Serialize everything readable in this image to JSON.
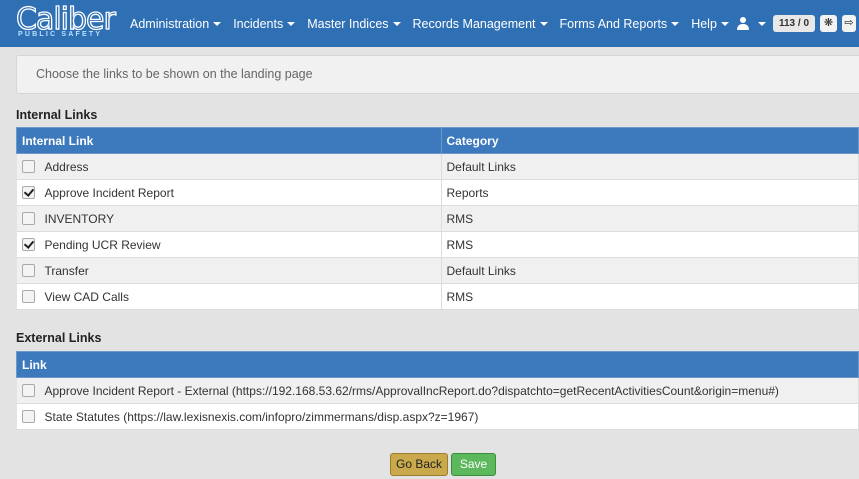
{
  "app": {
    "logo_text": "Caliber",
    "logo_subtext": "PUBLIC SAFETY"
  },
  "nav": {
    "items": [
      {
        "label": "Administration"
      },
      {
        "label": "Incidents"
      },
      {
        "label": "Master Indices"
      },
      {
        "label": "Records Management"
      },
      {
        "label": "Forms And Reports"
      },
      {
        "label": "Help"
      }
    ],
    "badge_count": "113 / 0",
    "icons": [
      "user-icon",
      "gear-icon",
      "logout-icon"
    ]
  },
  "banner": {
    "text": "Choose the links to be shown on the landing page"
  },
  "internal": {
    "title": "Internal Links",
    "headers": {
      "link": "Internal Link",
      "category": "Category"
    },
    "rows": [
      {
        "label": "Address",
        "category": "Default Links",
        "checked": false
      },
      {
        "label": "Approve Incident Report",
        "category": "Reports",
        "checked": true
      },
      {
        "label": "INVENTORY",
        "category": "RMS",
        "checked": false
      },
      {
        "label": "Pending UCR Review",
        "category": "RMS",
        "checked": true
      },
      {
        "label": "Transfer",
        "category": "Default Links",
        "checked": false
      },
      {
        "label": "View CAD Calls",
        "category": "RMS",
        "checked": false
      }
    ]
  },
  "external": {
    "title": "External Links",
    "headers": {
      "link": "Link"
    },
    "rows": [
      {
        "label": "Approve Incident Report - External  (https://192.168.53.62/rms/ApprovalIncReport.do?dispatchto=getRecentActivitiesCount&origin=menu#)",
        "checked": false
      },
      {
        "label": "State Statutes (https://law.lexisnexis.com/infopro/zimmermans/disp.aspx?z=1967)",
        "checked": false
      }
    ]
  },
  "buttons": {
    "back": "Go Back",
    "save": "Save"
  },
  "colors": {
    "navbar": "#2f6fb4",
    "table_header": "#3d79bd",
    "back_button": "#c9a94c",
    "save_button": "#5cb85c"
  }
}
